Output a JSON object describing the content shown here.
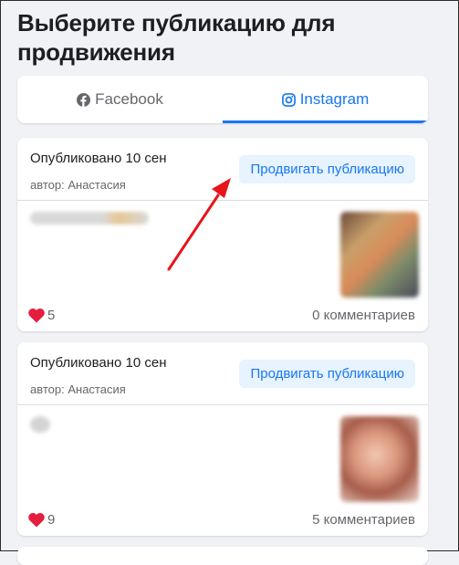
{
  "page": {
    "title": "Выберите публикацию для продвижения"
  },
  "tabs": [
    {
      "label": "Facebook",
      "icon": "facebook-icon",
      "active": false
    },
    {
      "label": "Instagram",
      "icon": "instagram-icon",
      "active": true
    }
  ],
  "posts": [
    {
      "published": "Опубликовано 10 сен",
      "author": "автор: Анастасия",
      "promote_label": "Продвигать публикацию",
      "likes": "5",
      "comments": "0 комментариев"
    },
    {
      "published": "Опубликовано 10 сен",
      "author": "автор: Анастасия",
      "promote_label": "Продвигать публикацию",
      "likes": "9",
      "comments": "5 комментариев"
    }
  ],
  "colors": {
    "accent": "#1877f2",
    "like": "#e41e3f",
    "annotation_arrow": "#e8141c"
  }
}
